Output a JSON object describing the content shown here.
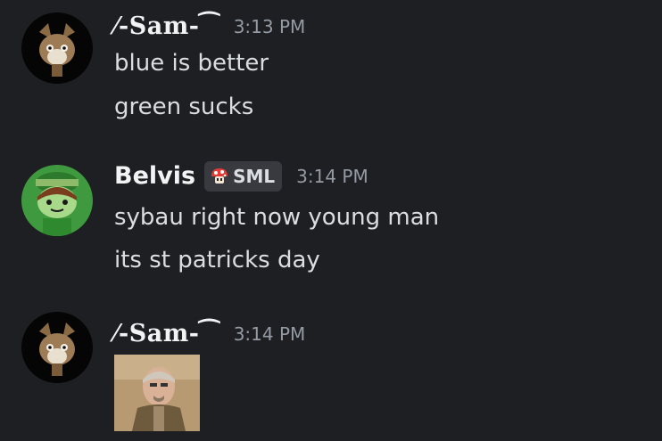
{
  "messages": [
    {
      "author": "⁄-Sam-⁀",
      "timestamp": "3:13 PM",
      "lines": [
        "blue is better",
        "green sucks"
      ]
    },
    {
      "author": "Belvis",
      "tag": "SML",
      "timestamp": "3:14 PM",
      "lines": [
        "sybau right now young man",
        "its st patricks day"
      ]
    },
    {
      "author": "⁄-Sam-⁀",
      "timestamp": "3:14 PM",
      "attachment": "gif-image"
    }
  ],
  "icons": {
    "tag_icon": "mushroom-icon"
  },
  "colors": {
    "background": "#1e1f22",
    "username": "#f2f3f5",
    "message_text": "#dbdee1",
    "timestamp": "#949ba4",
    "tag_background": "#383a40"
  }
}
